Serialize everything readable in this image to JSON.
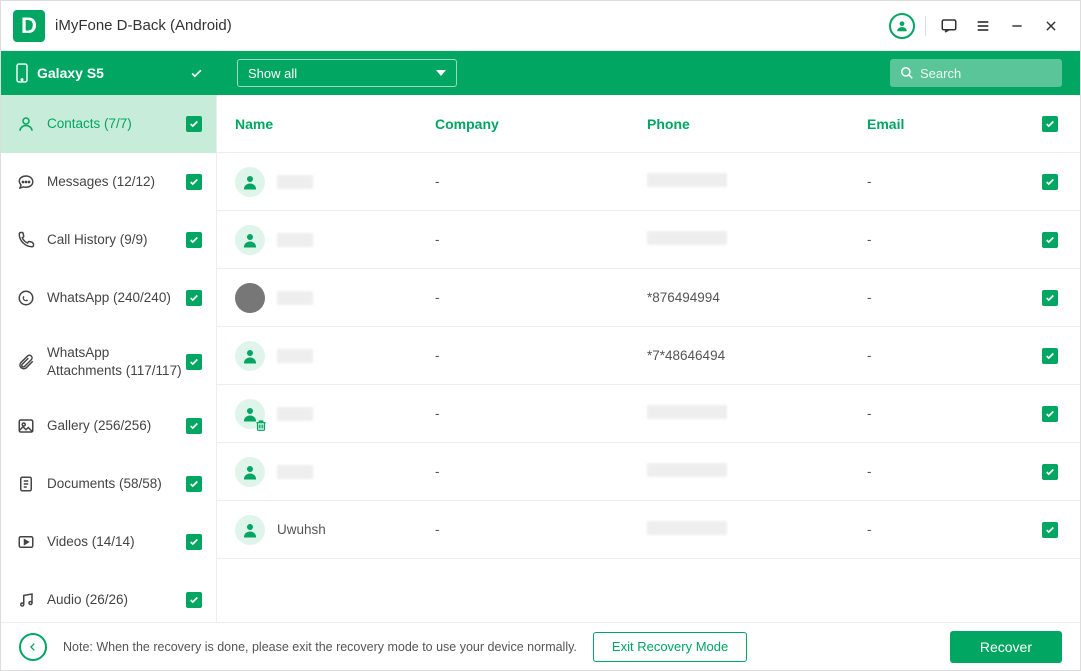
{
  "titlebar": {
    "app_title": "iMyFone D-Back (Android)"
  },
  "device": {
    "name": "Galaxy S5"
  },
  "filter": {
    "label": "Show all"
  },
  "search": {
    "placeholder": "Search"
  },
  "sidebar": {
    "items": [
      {
        "label": "Contacts (7/7)",
        "icon": "contact",
        "active": true
      },
      {
        "label": "Messages (12/12)",
        "icon": "message"
      },
      {
        "label": "Call History (9/9)",
        "icon": "phone"
      },
      {
        "label": "WhatsApp (240/240)",
        "icon": "whatsapp"
      },
      {
        "label": "WhatsApp Attachments (117/117)",
        "icon": "attachment",
        "tall": true
      },
      {
        "label": "Gallery (256/256)",
        "icon": "gallery"
      },
      {
        "label": "Documents (58/58)",
        "icon": "document"
      },
      {
        "label": "Videos (14/14)",
        "icon": "video"
      },
      {
        "label": "Audio (26/26)",
        "icon": "audio"
      }
    ]
  },
  "table": {
    "headers": {
      "name": "Name",
      "company": "Company",
      "phone": "Phone",
      "email": "Email"
    },
    "rows": [
      {
        "name_blurred": true,
        "company": "-",
        "phone_blurred": true,
        "email": "-",
        "avatar": "default"
      },
      {
        "name_blurred": true,
        "company": "-",
        "phone_blurred": true,
        "email": "-",
        "avatar": "default"
      },
      {
        "name_blurred": true,
        "company": "-",
        "phone": "*876494994",
        "email": "-",
        "avatar": "photo"
      },
      {
        "name_blurred": true,
        "company": "-",
        "phone": "*7*48646494",
        "email": "-",
        "avatar": "default"
      },
      {
        "name_blurred": true,
        "company": "-",
        "phone_blurred": true,
        "email": "-",
        "avatar": "default",
        "deleted": true
      },
      {
        "name_blurred": true,
        "company": "-",
        "phone_blurred": true,
        "email": "-",
        "avatar": "default"
      },
      {
        "name": "Uwuhsh",
        "company": "-",
        "phone_blurred": true,
        "email": "-",
        "avatar": "default"
      }
    ]
  },
  "footer": {
    "note": "Note: When the recovery is done, please exit the recovery mode to use your device normally.",
    "exit_label": "Exit Recovery Mode",
    "recover_label": "Recover"
  }
}
